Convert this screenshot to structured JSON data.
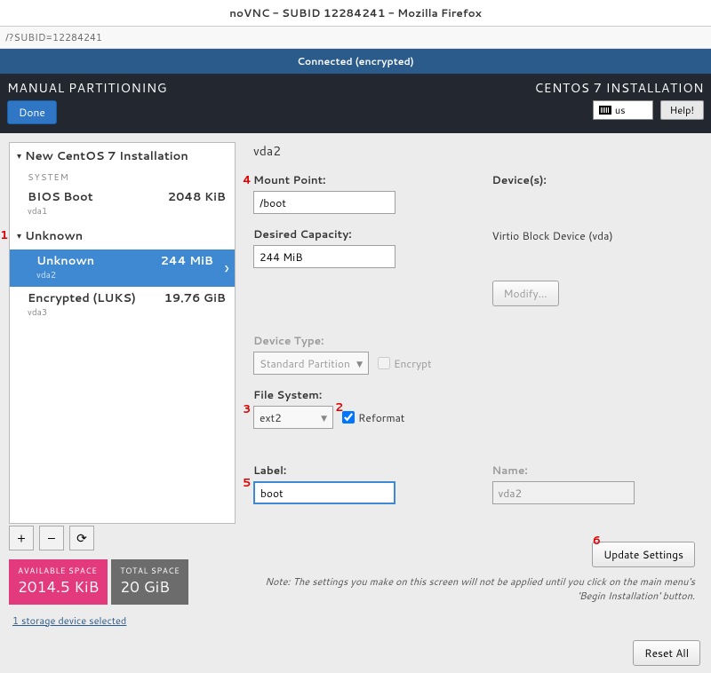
{
  "window_title": "noVNC - SUBID 12284241 - Mozilla Firefox",
  "url": "/?SUBID=12284241",
  "vnc_status": "Connected (encrypted)",
  "header": {
    "title": "MANUAL PARTITIONING",
    "done": "Done",
    "install_title": "CENTOS 7 INSTALLATION",
    "kb": "us",
    "help": "Help!"
  },
  "tree": {
    "title": "New CentOS 7 Installation",
    "system_label": "SYSTEM",
    "items_system": [
      {
        "label": "BIOS Boot",
        "dev": "vda1",
        "size": "2048 KiB"
      }
    ],
    "unknown_label": "Unknown",
    "items_unknown": [
      {
        "label": "Unknown",
        "dev": "vda2",
        "size": "244 MiB"
      },
      {
        "label": "Encrypted (LUKS)",
        "dev": "vda3",
        "size": "19.76 GiB"
      }
    ],
    "tools": {
      "add": "+",
      "remove": "–",
      "reload": "⟳"
    }
  },
  "badges": {
    "avail_label": "AVAILABLE SPACE",
    "avail_value": "2014.5 KiB",
    "total_label": "TOTAL SPACE",
    "total_value": "20 GiB"
  },
  "storage_link": "1 storage device selected",
  "panel": {
    "title": "vda2",
    "mount_label": "Mount Point:",
    "mount_value": "/boot",
    "devices_label": "Device(s):",
    "capacity_label": "Desired Capacity:",
    "capacity_value": "244 MiB",
    "device_text": "Virtio Block Device (vda)",
    "modify_btn": "Modify...",
    "devtype_label": "Device Type:",
    "devtype_value": "Standard Partition",
    "encrypt_label": "Encrypt",
    "fs_label": "File System:",
    "fs_value": "ext2",
    "reformat_label": "Reformat",
    "label_label": "Label:",
    "label_value": "boot",
    "name_label": "Name:",
    "name_value": "vda2",
    "update_btn": "Update Settings",
    "note": "Note:  The settings you make on this screen will not be applied until you click on the main menu's 'Begin Installation' button."
  },
  "reset_btn": "Reset All",
  "markers": {
    "m1": "1",
    "m2": "2",
    "m3": "3",
    "m4": "4",
    "m5": "5",
    "m6": "6"
  }
}
